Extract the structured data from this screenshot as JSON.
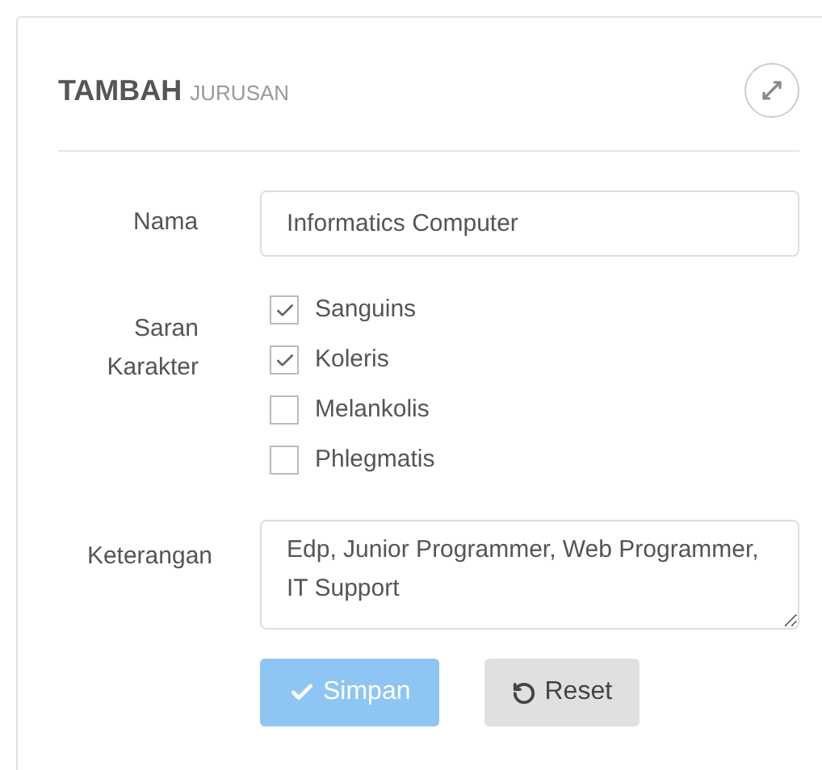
{
  "panel": {
    "title": "TAMBAH",
    "subtitle": "JURUSAN"
  },
  "form": {
    "nama": {
      "label": "Nama",
      "value": "Informatics Computer"
    },
    "saran": {
      "label": "Saran Karakter",
      "options": [
        {
          "label": "Sanguins",
          "checked": true
        },
        {
          "label": "Koleris",
          "checked": true
        },
        {
          "label": "Melankolis",
          "checked": false
        },
        {
          "label": "Phlegmatis",
          "checked": false
        }
      ]
    },
    "keterangan": {
      "label": "Keterangan",
      "value": "Edp, Junior Programmer, Web Programmer, IT Support"
    }
  },
  "buttons": [
    {
      "label": "Simpan",
      "kind": "primary",
      "disabled": true
    },
    {
      "label": "Reset",
      "kind": "reset",
      "disabled": false
    }
  ]
}
